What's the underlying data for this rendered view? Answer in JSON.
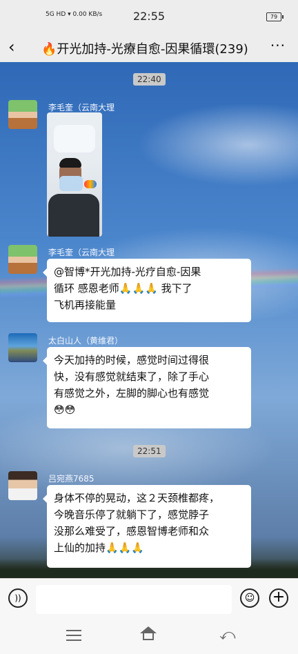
{
  "statusbar": {
    "signal_text": "5G HD",
    "net_speed": "0.00 KB/s",
    "time": "22:55",
    "battery": "79"
  },
  "header": {
    "back_icon": "‹",
    "title": "🔥开光加持-光療自愈-因果循環(239)",
    "more_icon": "···"
  },
  "chat": {
    "timestamps": [
      "22:40",
      "22:51"
    ],
    "messages": [
      {
        "sender": "李毛奎（云南大理",
        "type": "image"
      },
      {
        "sender": "李毛奎（云南大理",
        "type": "text",
        "lines": [
          "@智博*开光加持-光疗自愈-因果",
          "循环  感恩老师🙏🙏🙏  我下了",
          "飞机再接能量"
        ]
      },
      {
        "sender": "太白山人（黄维君）",
        "type": "text",
        "lines": [
          "今天加持的时候，感觉时间过得很",
          "快，没有感觉就结束了，除了手心",
          "有感觉之外，左脚的脚心也有感觉",
          "😳😳"
        ]
      },
      {
        "sender": "吕宛燕7685",
        "type": "text",
        "lines": [
          "身体不停的晃动，这２天颈椎都疼，",
          "今晚音乐停了就躺下了，感觉脖子",
          "没那么难受了，感恩智博老师和众",
          "上仙的加持🙏🙏🙏"
        ]
      }
    ]
  },
  "inputbar": {
    "placeholder": "",
    "voice_icon": "voice-icon",
    "emoji_icon": "emoji-icon",
    "plus_icon": "plus-icon"
  },
  "navbar": {
    "menu_icon": "menu-icon",
    "home_icon": "home-icon",
    "back_icon": "back-icon"
  }
}
